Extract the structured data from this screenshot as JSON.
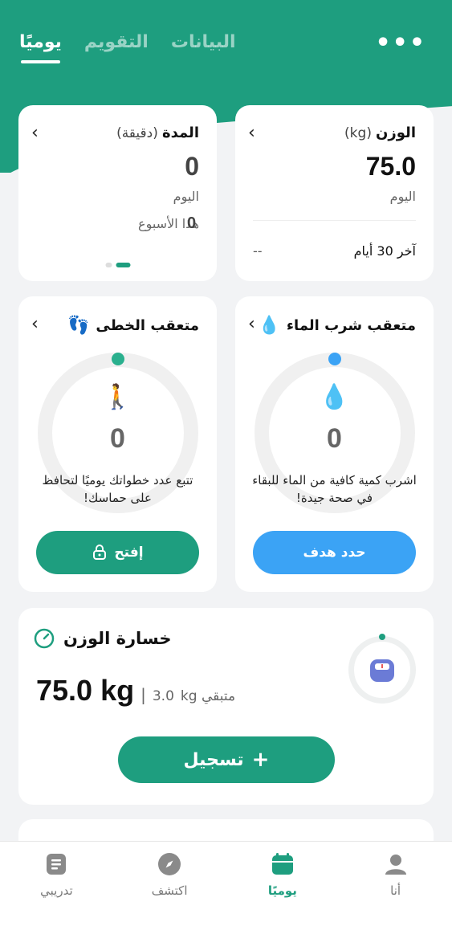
{
  "header": {
    "tabs": [
      {
        "label": "يوميًا",
        "active": true
      },
      {
        "label": "التقويم",
        "active": false
      },
      {
        "label": "البيانات",
        "active": false
      }
    ],
    "more_icon": "more-horizontal-icon"
  },
  "weight_card": {
    "title": "الوزن",
    "unit": "(kg)",
    "value": "75.0",
    "period": "اليوم",
    "last_label": "آخر 30 أيام",
    "last_value": "--"
  },
  "duration_card": {
    "title": "المدة",
    "unit": "(دقيقة)",
    "value": "0",
    "period": "اليوم",
    "week_label": "هذا الأسبوع",
    "week_value": "0"
  },
  "water_card": {
    "title": "متعقب شرب الماء",
    "value": "0",
    "desc": "اشرب كمية كافية من الماء للبقاء في صحة جيدة!",
    "button": "حدد هدف",
    "accent": "#3ba3f5"
  },
  "steps_card": {
    "title": "متعقب الخطى",
    "value": "0",
    "desc": "تتبع عدد خطواتك يوميًا لتحافظ على حماسك!",
    "button": "إفتح",
    "accent": "#1e9e7f"
  },
  "loss_card": {
    "title": "خسارة الوزن",
    "current": "75.0 kg",
    "remaining_label": "kg متبقي",
    "remaining_value": "3.0",
    "register": "تسجيل"
  },
  "bottom_nav": [
    {
      "label": "تدريبي",
      "icon": "clipboard-icon",
      "active": false
    },
    {
      "label": "اكتشف",
      "icon": "compass-icon",
      "active": false
    },
    {
      "label": "يوميًا",
      "icon": "calendar-icon",
      "active": true
    },
    {
      "label": "أنا",
      "icon": "user-icon",
      "active": false
    }
  ],
  "colors": {
    "brand": "#1e9e7f",
    "blue": "#3ba3f5"
  }
}
